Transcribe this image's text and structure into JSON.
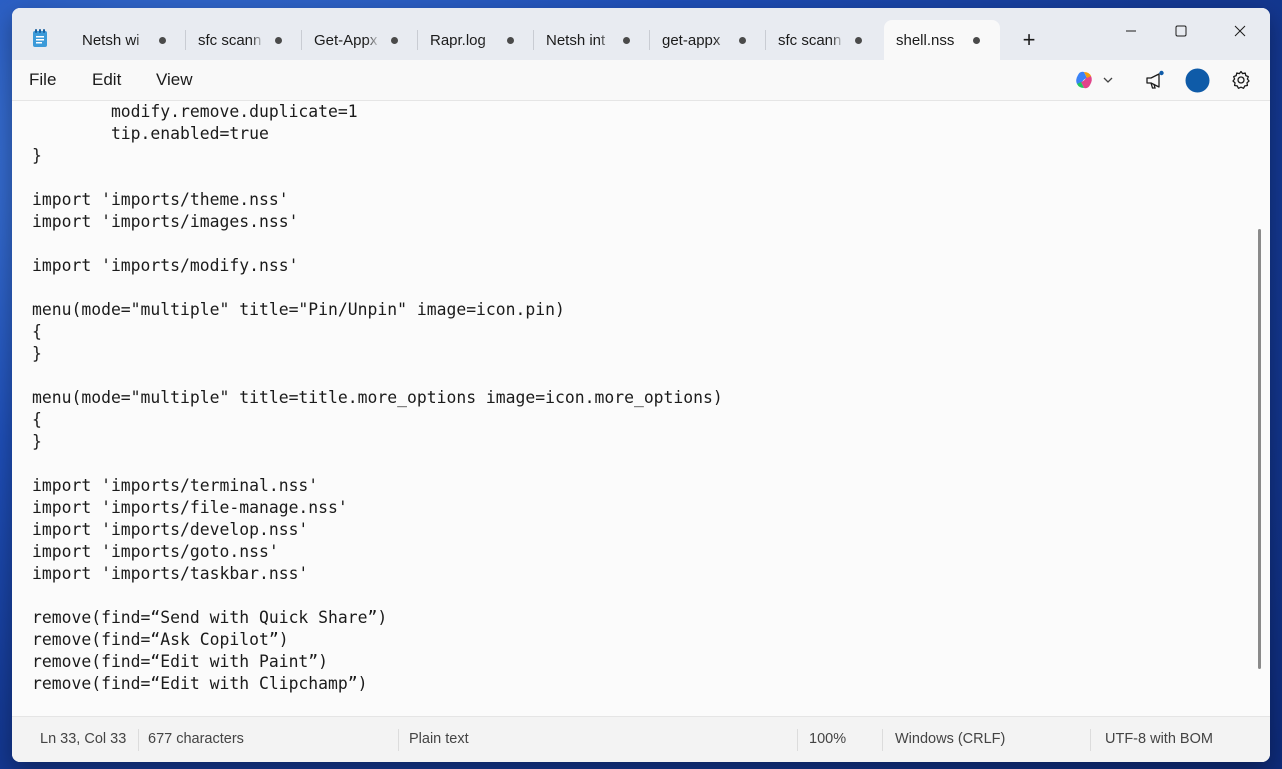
{
  "tabs": [
    {
      "label": "Netsh wi",
      "active": false
    },
    {
      "label": "sfc scann",
      "active": false
    },
    {
      "label": "Get-Appx",
      "active": false
    },
    {
      "label": "Rapr.log",
      "active": false
    },
    {
      "label": "Netsh int",
      "active": false
    },
    {
      "label": "get-appx",
      "active": false
    },
    {
      "label": "sfc scann",
      "active": false
    },
    {
      "label": "shell.nss",
      "active": true
    }
  ],
  "new_tab_label": "+",
  "menu": {
    "file": "File",
    "edit": "Edit",
    "view": "View"
  },
  "toolbar": {
    "copilot_icon": "copilot-icon",
    "account_color": "#0f5ba8"
  },
  "editor": {
    "content": "        modify.remove.duplicate=1\n        tip.enabled=true\n}\n\nimport 'imports/theme.nss'\nimport 'imports/images.nss'\n\nimport 'imports/modify.nss'\n\nmenu(mode=\"multiple\" title=\"Pin/Unpin\" image=icon.pin)\n{\n}\n\nmenu(mode=\"multiple\" title=title.more_options image=icon.more_options)\n{\n}\n\nimport 'imports/terminal.nss'\nimport 'imports/file-manage.nss'\nimport 'imports/develop.nss'\nimport 'imports/goto.nss'\nimport 'imports/taskbar.nss'\n\nremove(find=“Send with Quick Share”)\nremove(find=“Ask Copilot”)\nremove(find=“Edit with Paint”)\nremove(find=“Edit with Clipchamp”)"
  },
  "status": {
    "position": "Ln 33, Col 33",
    "characters": "677 characters",
    "format": "Plain text",
    "zoom": "100%",
    "line_ending": "Windows (CRLF)",
    "encoding": "UTF-8 with BOM"
  }
}
